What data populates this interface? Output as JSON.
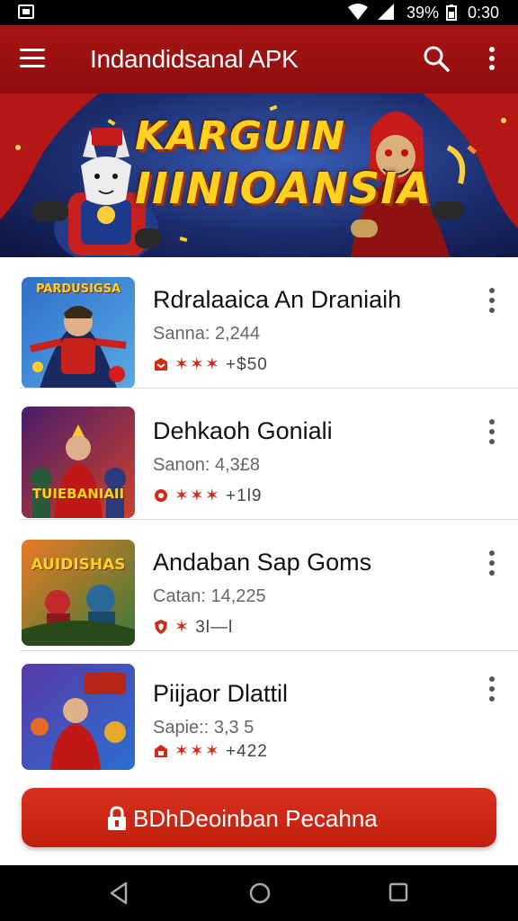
{
  "status_bar": {
    "battery": "39%",
    "time": "0:30",
    "icons": [
      "notification-icon",
      "wifi-icon",
      "signal-icon",
      "battery-icon"
    ]
  },
  "app_bar": {
    "title": "Indandidsanal APK",
    "icons": [
      "menu-icon",
      "search-icon",
      "more-vert-icon"
    ],
    "background": "#a81414"
  },
  "banner": {
    "line1": "KARGUIN",
    "line2": "IIINIOANSIA",
    "accent": "#ffd21f"
  },
  "apps": [
    {
      "title": "Rdralaaica An Draniaih",
      "subtitle": "Sanna: 2,244",
      "rating_text": "✶✶✶",
      "price": "+$50",
      "thumb_text": "PARDUSIGSA",
      "thumb_colors": [
        "#2f6fc9",
        "#58a9e6"
      ]
    },
    {
      "title": "Dehkaoh Goniali",
      "subtitle": "Sanon: 4,3£8",
      "rating_text": "✶✶✶",
      "price": "+1l9",
      "thumb_text": "TUIEBANIAII",
      "thumb_colors": [
        "#4a1d6a",
        "#d0422a"
      ]
    },
    {
      "title": "Andaban Sap Goms",
      "subtitle": "Catan: 14,225",
      "rating_text": "✶",
      "price": "3l—l",
      "thumb_text": "AUIDISHAS",
      "thumb_colors": [
        "#e87a24",
        "#3a7a3a"
      ]
    },
    {
      "title": "Piijaor Dlattil",
      "subtitle": "Sapie:: 3,3 5",
      "rating_text": "✶✶✶",
      "price": "+422",
      "thumb_text": "",
      "thumb_colors": [
        "#5a3aa8",
        "#2a6fd0"
      ]
    }
  ],
  "cta": {
    "label": "BDhDeoinban Pecahna",
    "color": "#d12a16"
  },
  "nav_bar": {
    "icons": [
      "back-icon",
      "home-icon",
      "recents-icon"
    ]
  }
}
